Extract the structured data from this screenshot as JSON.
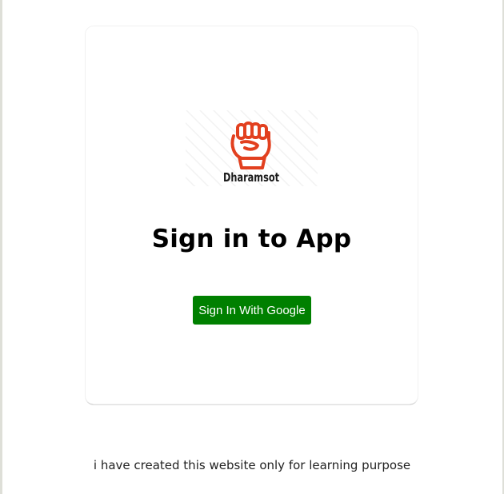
{
  "logo": {
    "text": "Dharamsot",
    "icon": "raised-fist-icon",
    "icon_color": "#e2401f"
  },
  "card": {
    "title": "Sign in to App",
    "google_button_label": "Sign In With Google",
    "button_color": "#008000"
  },
  "footer": {
    "note": "i have created this website only for learning purpose"
  }
}
